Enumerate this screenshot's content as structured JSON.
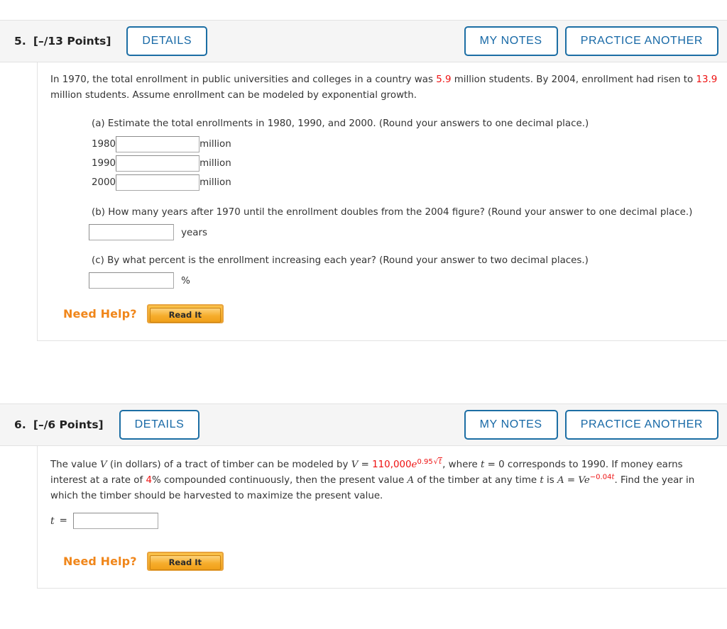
{
  "problems": [
    {
      "number": "5.",
      "points": "[–/13 Points]",
      "details_label": "DETAILS",
      "my_notes_label": "MY NOTES",
      "practice_label": "PRACTICE ANOTHER",
      "stem": {
        "line1_a": "In 1970, the total enrollment in public universities and colleges in a country was ",
        "value1": "5.9",
        "line1_b": " million students. By 2004, enrollment had risen to ",
        "value2": "13.9",
        "line1_c": " million students. Assume enrollment can be modeled by exponential growth."
      },
      "part_a": {
        "label": "(a) Estimate the total enrollments in 1980, 1990, and 2000. (Round your answers to one decimal place.)",
        "rows": [
          {
            "year": "1980",
            "value": "",
            "unit": "million"
          },
          {
            "year": "1990",
            "value": "",
            "unit": "million"
          },
          {
            "year": "2000",
            "value": "",
            "unit": "million"
          }
        ]
      },
      "part_b": {
        "label": "(b) How many years after 1970 until the enrollment doubles from the 2004 figure? (Round your answer to one decimal place.)",
        "value": "",
        "unit": "years"
      },
      "part_c": {
        "label": "(c) By what percent is the enrollment increasing each year? (Round your answer to two decimal places.)",
        "value": "",
        "unit": "%"
      },
      "need_help_label": "Need Help?",
      "read_it_label": "Read It"
    },
    {
      "number": "6.",
      "points": "[–/6 Points]",
      "details_label": "DETAILS",
      "my_notes_label": "MY NOTES",
      "practice_label": "PRACTICE ANOTHER",
      "stem": {
        "s1": "The value ",
        "var_v": "V",
        "s2": " (in dollars) of a tract of timber can be modeled by ",
        "var_v2": "V",
        "s3": " = ",
        "coef": "110,000",
        "e1": "e",
        "exp_coef": "0.95",
        "exp_sqrt": "√",
        "exp_rad": "t",
        "s4": ", where ",
        "var_t": "t",
        "s5": " = 0 corresponds to 1990. If money earns interest at a rate of ",
        "rate": "4",
        "s6": "% compounded continuously, then the present value ",
        "var_a": "A",
        "s7": " of the timber at any time ",
        "var_t2": "t",
        "s8": " is ",
        "var_a2": "A",
        "s9": " = ",
        "var_ve": "Ve",
        "exp2": "−0.04",
        "exp2_t": "t",
        "s10": ". Find the year in which the timber should be harvested to maximize the present value."
      },
      "t_answer": {
        "label": "t",
        "equals": "=",
        "value": ""
      },
      "need_help_label": "Need Help?",
      "read_it_label": "Read It"
    }
  ],
  "colors": {
    "accent_blue": "#1668a6",
    "header_bg": "#f5f5f5",
    "value_red": "#ee1111",
    "need_help_orange": "#f0861a"
  }
}
